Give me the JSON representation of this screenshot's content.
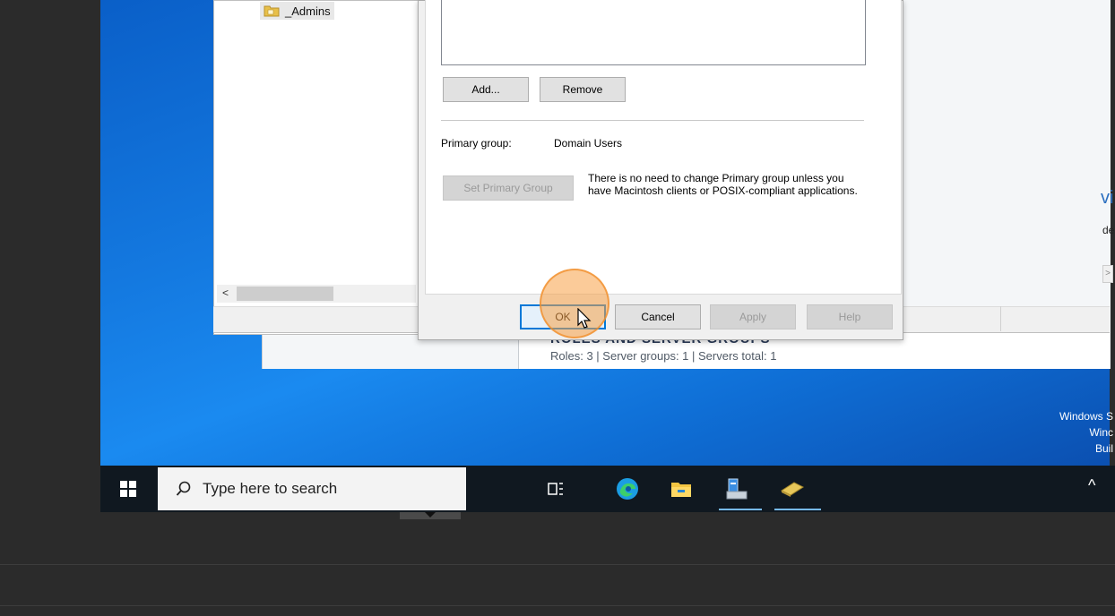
{
  "tree": {
    "admins_label": "_Admins"
  },
  "dialog": {
    "buttons": {
      "add": "Add...",
      "remove": "Remove",
      "set_primary": "Set Primary Group",
      "ok": "OK",
      "cancel": "Cancel",
      "apply": "Apply",
      "help": "Help"
    },
    "primary_group_label": "Primary group:",
    "primary_group_value": "Domain Users",
    "primary_note": "There is no need to change Primary group unless you have Macintosh clients or POSIX-compliant applications."
  },
  "server_manager": {
    "section_heading": "ROLES AND SERVER GROUPS",
    "stats": "Roles: 3  |  Server groups: 1  |  Servers total: 1",
    "right_text_1": "vi",
    "right_text_2": "de",
    "scroll_arrow": ">"
  },
  "aduc": {
    "scroll_left": "<"
  },
  "branding": {
    "line1": "Windows S",
    "line2": "Winc",
    "line3": "Buil"
  },
  "taskbar": {
    "search_placeholder": "Type here to search",
    "icons": [
      "windows-start-icon",
      "search-icon",
      "task-view-icon",
      "edge-icon",
      "file-explorer-icon",
      "server-manager-icon",
      "active-directory-icon",
      "chevron-up-icon"
    ],
    "chevron": "^"
  },
  "colors": {
    "desktop_blue": "#1479e0",
    "accent": "#0078d7",
    "taskbar": "#101820",
    "highlight": "#f7a046"
  }
}
